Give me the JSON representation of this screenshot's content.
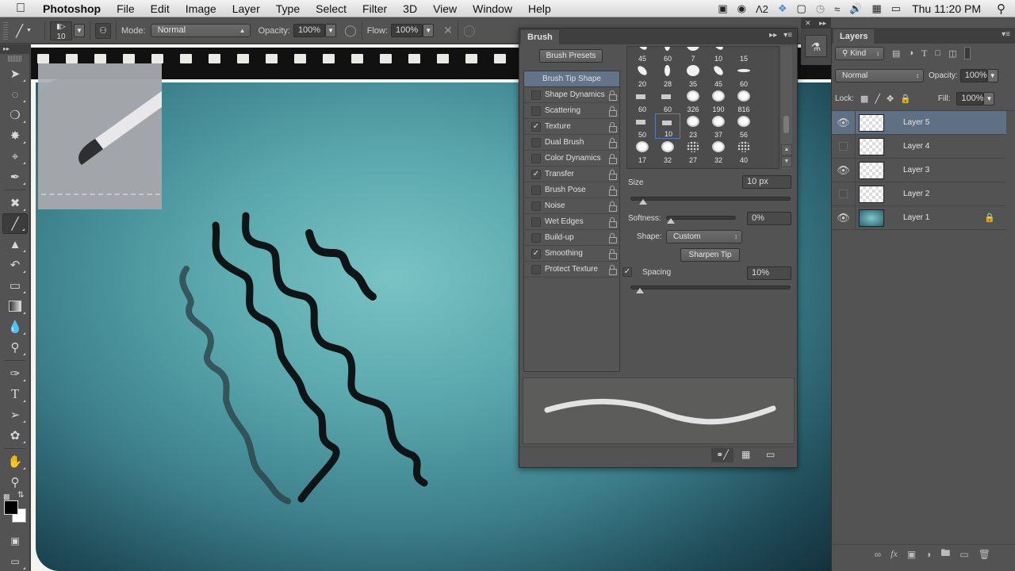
{
  "menubar": {
    "app_name": "Photoshop",
    "items": [
      "File",
      "Edit",
      "Image",
      "Layer",
      "Type",
      "Select",
      "Filter",
      "3D",
      "View",
      "Window",
      "Help"
    ],
    "status": {
      "adobe_count": "2",
      "clock": "Thu 11:20 PM"
    }
  },
  "options": {
    "brush_size": "10",
    "mode_label": "Mode:",
    "mode_value": "Normal",
    "opacity_label": "Opacity:",
    "opacity_value": "100%",
    "flow_label": "Flow:",
    "flow_value": "100%"
  },
  "brush_panel": {
    "tab": "Brush",
    "presets_button": "Brush Presets",
    "list": [
      {
        "label": "Brush Tip Shape",
        "active": true
      },
      {
        "label": "Shape Dynamics",
        "checked": false
      },
      {
        "label": "Scattering",
        "checked": false
      },
      {
        "label": "Texture",
        "checked": true
      },
      {
        "label": "Dual Brush",
        "checked": false
      },
      {
        "label": "Color Dynamics",
        "checked": false
      },
      {
        "label": "Transfer",
        "checked": true
      },
      {
        "label": "Brush Pose",
        "checked": false
      },
      {
        "label": "Noise",
        "checked": false
      },
      {
        "label": "Wet Edges",
        "checked": false
      },
      {
        "label": "Build-up",
        "checked": false
      },
      {
        "label": "Smoothing",
        "checked": true
      },
      {
        "label": "Protect Texture",
        "checked": false
      }
    ],
    "tips": [
      [
        "45",
        "60",
        "7",
        "10",
        "15"
      ],
      [
        "20",
        "28",
        "35",
        "45",
        "60"
      ],
      [
        "60",
        "60",
        "326",
        "190",
        "816"
      ],
      [
        "50",
        "10",
        "23",
        "37",
        "56"
      ],
      [
        "17",
        "32",
        "27",
        "32",
        "40"
      ]
    ],
    "selected_tip": "10",
    "size_label": "Size",
    "size_value": "10 px",
    "softness_label": "Softness:",
    "softness_value": "0%",
    "shape_label": "Shape:",
    "shape_value": "Custom",
    "sharpen_button": "Sharpen Tip",
    "spacing_label": "Spacing",
    "spacing_checked": true,
    "spacing_value": "10%",
    "size_fraction": 0.05,
    "softness_fraction": 0.0,
    "spacing_fraction": 0.03
  },
  "layers_panel": {
    "tab": "Layers",
    "filter_kind": "Kind",
    "blend_mode": "Normal",
    "opacity_label": "Opacity:",
    "opacity_value": "100%",
    "lock_label": "Lock:",
    "fill_label": "Fill:",
    "fill_value": "100%",
    "layers": [
      {
        "name": "Layer 5",
        "visible": true,
        "selected": true
      },
      {
        "name": "Layer 4",
        "visible": false
      },
      {
        "name": "Layer 3",
        "visible": true
      },
      {
        "name": "Layer 2",
        "visible": false
      },
      {
        "name": "Layer 1",
        "visible": true,
        "locked": true
      }
    ]
  },
  "toolbox": {
    "tools": [
      "move",
      "marquee",
      "lasso",
      "magic-wand",
      "crop",
      "eyedropper",
      "spot-healing",
      "brush",
      "clone-stamp",
      "history-brush",
      "eraser",
      "gradient",
      "blur",
      "dodge",
      "pen",
      "type",
      "path-selection",
      "shape",
      "hand",
      "zoom"
    ],
    "selected": "brush",
    "foreground": "#000000",
    "background": "#ffffff"
  }
}
